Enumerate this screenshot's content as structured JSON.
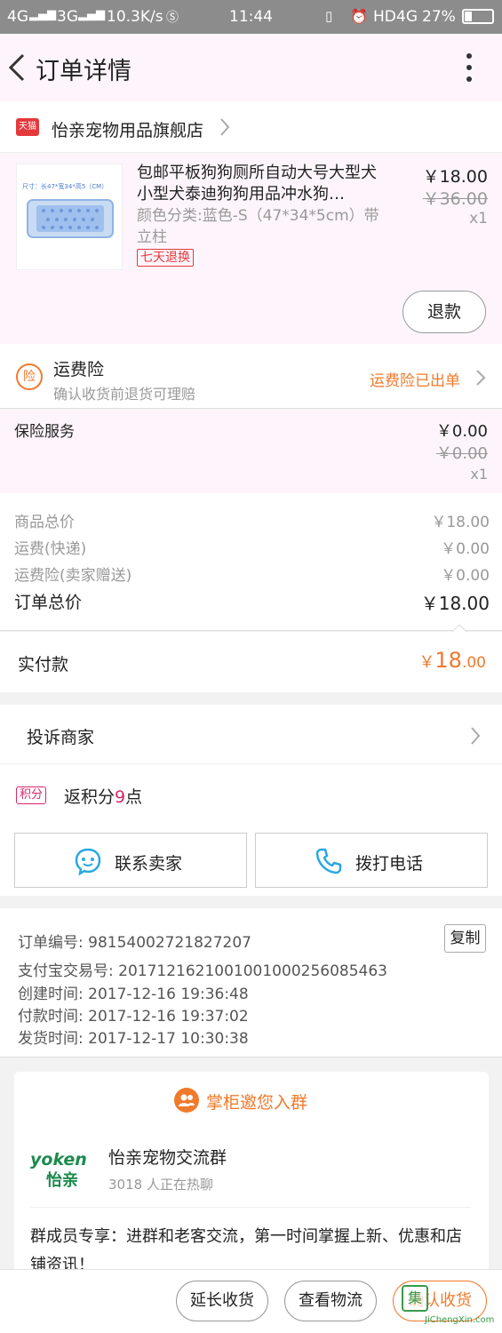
{
  "status_bar": {
    "network1": "4G",
    "network2": "3G",
    "speed": "10.3K/s",
    "time": "11:44",
    "hd": "HD",
    "network3": "4G",
    "battery": "27%"
  },
  "header": {
    "title": "订单详情"
  },
  "store": {
    "badge": "天猫",
    "name": "怡亲宠物用品旗舰店"
  },
  "product": {
    "thumb_caption": "尺寸：长47*宽34*高5（CM）",
    "title": "包邮平板狗狗厕所自动大号大型犬小型犬泰迪狗狗用品冲水狗…",
    "attributes": "颜色分类:蓝色-S（47*34*5cm）带立柱",
    "tag": "七天退换",
    "price": "￥18.00",
    "original_price": "￥36.00",
    "quantity": "x1",
    "refund_label": "退款"
  },
  "shipping_insurance": {
    "icon_text": "险",
    "title": "运费险",
    "subtitle": "确认收货前退货可理赔",
    "status": "运费险已出单"
  },
  "insurance_service": {
    "name": "保险服务",
    "price": "￥0.00",
    "original_price": "￥0.00",
    "quantity": "x1"
  },
  "totals": {
    "goods_label": "商品总价",
    "goods_value": "￥18.00",
    "shipping_label": "运费(快递)",
    "shipping_value": "￥0.00",
    "insurance_label": "运费险(卖家赠送)",
    "insurance_value": "￥0.00",
    "order_label": "订单总价",
    "order_value": "￥18.00"
  },
  "paid": {
    "label": "实付款",
    "symbol": "￥",
    "int": "18",
    "dec": ".00"
  },
  "complaint": {
    "label": "投诉商家"
  },
  "points": {
    "badge": "积分",
    "prefix": "返积分",
    "number": "9",
    "suffix": "点"
  },
  "contact": {
    "seller_label": "联系卖家",
    "call_label": "拨打电话"
  },
  "order_info": {
    "order_no": "订单编号: 98154002721827207",
    "alipay_no": "支付宝交易号: 2017121621001001000256085463",
    "created": "创建时间: 2017-12-16 19:36:48",
    "paid_time": "付款时间: 2017-12-16 19:37:02",
    "shipped": "发货时间: 2017-12-17 10:30:38",
    "copy_label": "复制"
  },
  "group": {
    "header": "掌柜邀您入群",
    "logo_top": "yoken",
    "logo_bottom": "怡亲",
    "name": "怡亲宠物交流群",
    "count": "3018 人正在热聊",
    "description": "群成员专享：进群和老客交流，第一时间掌握上新、优惠和店铺资讯！"
  },
  "bottom_bar": {
    "extend_label": "延长收货",
    "logistics_label": "查看物流",
    "confirm_label": "确认收货"
  },
  "watermark": {
    "icon": "集",
    "text": "JiChengXin.com"
  },
  "colors": {
    "accent": "#f07a2c",
    "tmall": "#e4393c",
    "points": "#d6266a",
    "header_bg": "#fdf5fb"
  }
}
